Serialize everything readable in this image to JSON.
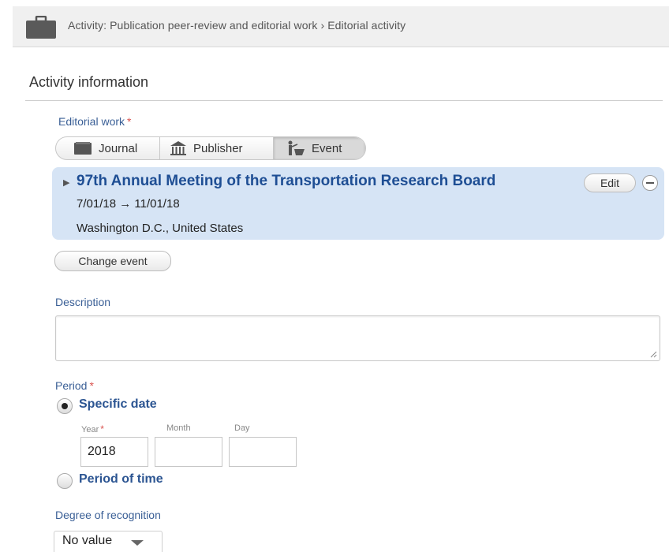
{
  "header": {
    "icon": "briefcase-icon",
    "breadcrumb_parent": "Activity: Publication peer-review and editorial work",
    "breadcrumb_separator": "›",
    "breadcrumb_current": "Editorial activity"
  },
  "section": {
    "title": "Activity information"
  },
  "editorial_work": {
    "label": "Editorial work",
    "required_mark": "*",
    "options": [
      {
        "label": "Journal",
        "icon": "journal-icon",
        "selected": false
      },
      {
        "label": "Publisher",
        "icon": "publisher-icon",
        "selected": false
      },
      {
        "label": "Event",
        "icon": "event-icon",
        "selected": true
      }
    ],
    "selected_event": {
      "title": "97th Annual Meeting of the Transportation Research Board",
      "dates": "7/01/18 → 11/01/18",
      "location": "Washington D.C., United States",
      "edit_label": "Edit"
    },
    "change_button": "Change event"
  },
  "description": {
    "label": "Description",
    "value": ""
  },
  "period": {
    "label": "Period",
    "required_mark": "*",
    "options": [
      {
        "label": "Specific date",
        "selected": true
      },
      {
        "label": "Period of time",
        "selected": false
      }
    ],
    "year_label": "Year",
    "year_required": "*",
    "month_label": "Month",
    "day_label": "Day",
    "year_value": "2018",
    "month_value": "",
    "day_value": ""
  },
  "recognition": {
    "label": "Degree of recognition",
    "selected": "No value"
  },
  "colors": {
    "label_blue": "#3a5f96",
    "title_blue": "#1e4e94",
    "required_red": "#d9534f",
    "card_bg": "#d6e4f5"
  }
}
